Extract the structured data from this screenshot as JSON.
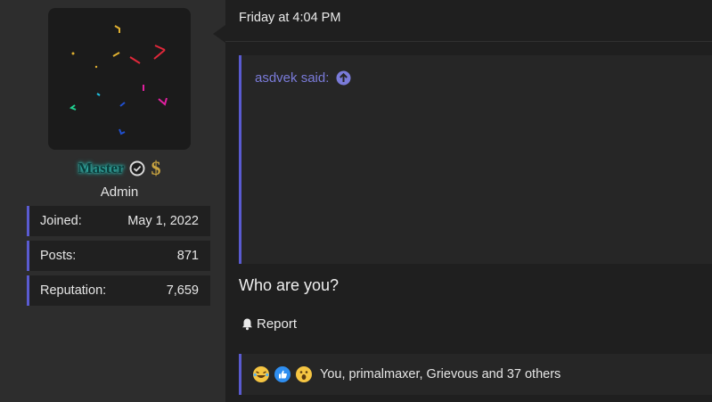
{
  "user": {
    "username": "Master",
    "title": "Admin",
    "icons": [
      "avatar",
      "verified-icon",
      "dollar-icon"
    ],
    "stats": [
      {
        "label": "Joined:",
        "value": "May 1, 2022"
      },
      {
        "label": "Posts:",
        "value": "871"
      },
      {
        "label": "Reputation:",
        "value": "7,659"
      }
    ]
  },
  "post": {
    "date": "Friday at 4:04 PM",
    "quote": {
      "attribution": "asdvek said:",
      "lines": []
    },
    "body": "Who are you?",
    "report_label": "Report",
    "reactions": {
      "icons": [
        "laughing-emoji-icon",
        "like-emoji-icon",
        "wow-emoji-icon"
      ],
      "text": "You, primalmaxer, Grievous and 37 others"
    }
  },
  "colors": {
    "accent": "#5a5bd0",
    "quote_attribution": "#7a7bd9",
    "username_glow": "#38e0d5",
    "dollar": "#c9a441"
  }
}
